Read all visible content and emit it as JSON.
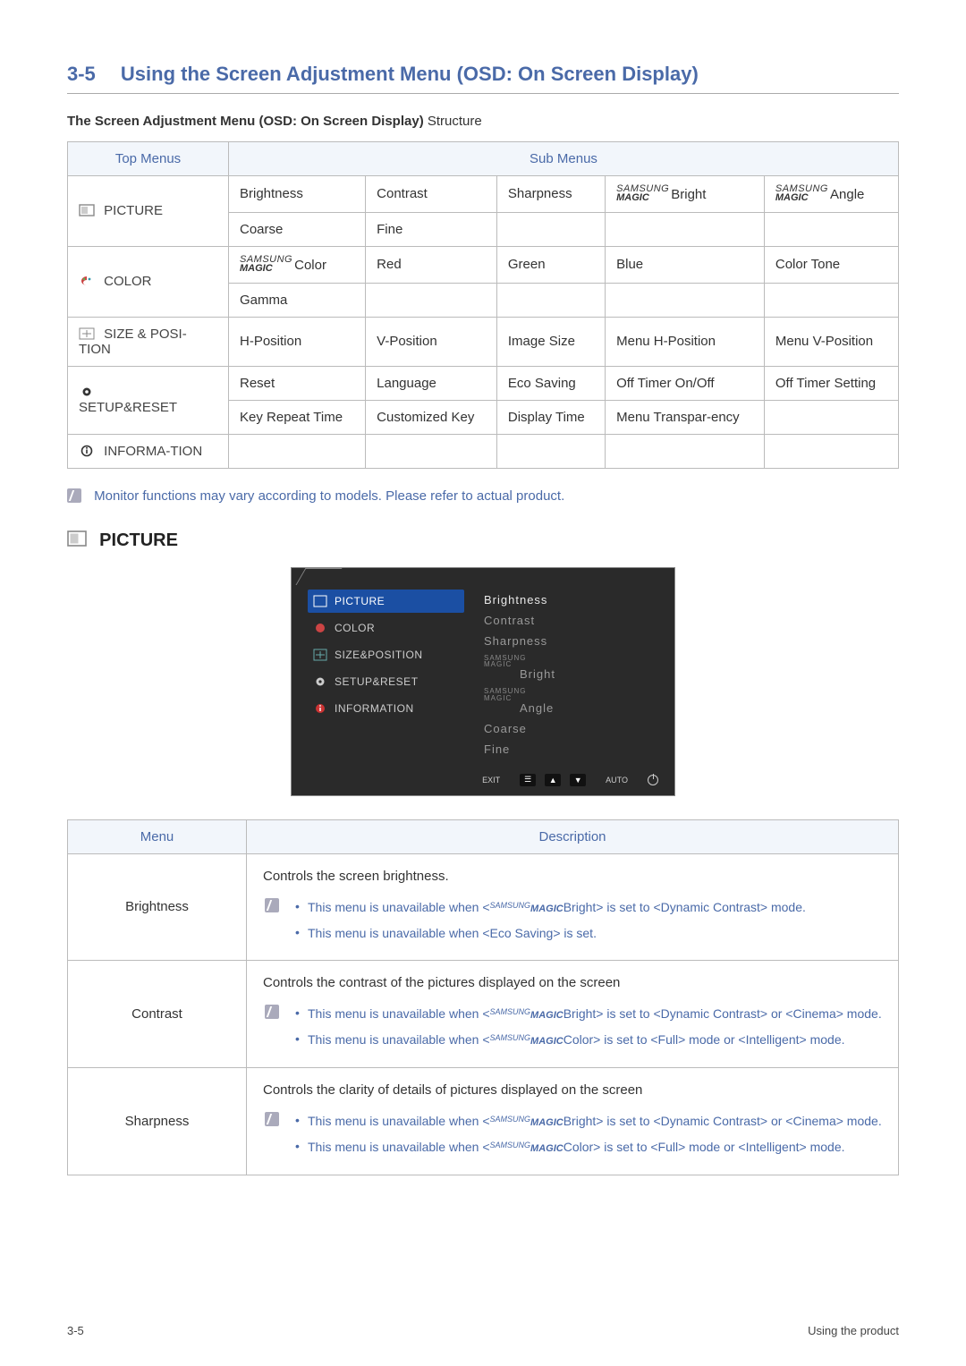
{
  "section": {
    "number": "3-5",
    "title": "Using the Screen Adjustment Menu (OSD: On Screen Display)"
  },
  "structure_heading": {
    "bold": "The Screen Adjustment Menu (OSD: On Screen Display)",
    "light": " Structure"
  },
  "table_headers": {
    "top": "Top Menus",
    "sub": "Sub Menus"
  },
  "magic": {
    "samsung": "SAMSUNG",
    "magic": "MAGIC"
  },
  "top_menus": {
    "picture": "PICTURE",
    "color": "COLOR",
    "size": "SIZE & POSI-TION",
    "setup": "SETUP&RESET",
    "info": "INFORMA-TION"
  },
  "sub": {
    "picture_row1": [
      "Brightness",
      "Contrast",
      "Sharpness",
      "Bright",
      "Angle"
    ],
    "picture_row2": [
      "Coarse",
      "Fine",
      "",
      "",
      ""
    ],
    "color_row1": [
      "Color",
      "Red",
      "Green",
      "Blue",
      "Color Tone"
    ],
    "color_row2": [
      "Gamma",
      "",
      "",
      "",
      ""
    ],
    "size_row1": [
      "H-Position",
      "V-Position",
      "Image Size",
      "Menu H-Position",
      "Menu V-Position"
    ],
    "setup_row1": [
      "Reset",
      "Language",
      "Eco Saving",
      "Off Timer On/Off",
      "Off Timer Setting"
    ],
    "setup_row2": [
      "Key Repeat Time",
      "Customized Key",
      "Display Time",
      "Menu Transpar-ency",
      ""
    ]
  },
  "note": "Monitor functions may vary according to models. Please refer to actual product.",
  "picture_heading": "PICTURE",
  "osd": {
    "left": [
      "PICTURE",
      "COLOR",
      "SIZE&POSITION",
      "SETUP&RESET",
      "INFORMATION"
    ],
    "right_plain": [
      "Brightness",
      "Contrast",
      "Sharpness"
    ],
    "right_magic": [
      "Bright",
      "Angle"
    ],
    "right_tail": [
      "Coarse",
      "Fine"
    ],
    "footer": {
      "exit": "EXIT",
      "auto": "AUTO"
    }
  },
  "desc_headers": {
    "menu": "Menu",
    "desc": "Description"
  },
  "desc": {
    "brightness": {
      "name": "Brightness",
      "intro": "Controls the screen brightness.",
      "items": [
        {
          "pre": "This menu is unavailable when <",
          "magic_suffix": "Bright",
          "post": "> is set to <Dynamic Contrast> mode."
        },
        {
          "pre": "This menu is unavailable when <Eco Saving> is set.",
          "magic_suffix": "",
          "post": ""
        }
      ]
    },
    "contrast": {
      "name": "Contrast",
      "intro": "Controls the contrast of the pictures displayed on the screen",
      "items": [
        {
          "pre": "This menu is unavailable when <",
          "magic_suffix": "Bright",
          "post": "> is set to <Dynamic Contrast> or <Cinema> mode."
        },
        {
          "pre": "This menu is unavailable when <",
          "magic_suffix": "Color",
          "post": "> is set to <Full> mode or <Intelligent> mode."
        }
      ]
    },
    "sharpness": {
      "name": "Sharpness",
      "intro": "Controls the clarity of details of pictures displayed on the screen",
      "items": [
        {
          "pre": "This menu is unavailable when <",
          "magic_suffix": "Bright",
          "post": "> is set to <Dynamic Contrast> or <Cinema> mode."
        },
        {
          "pre": "This menu is unavailable when <",
          "magic_suffix": "Color",
          "post": "> is set to <Full> mode or <Intelligent> mode."
        }
      ]
    }
  },
  "footer": {
    "left": "3-5",
    "right": "Using the product"
  }
}
